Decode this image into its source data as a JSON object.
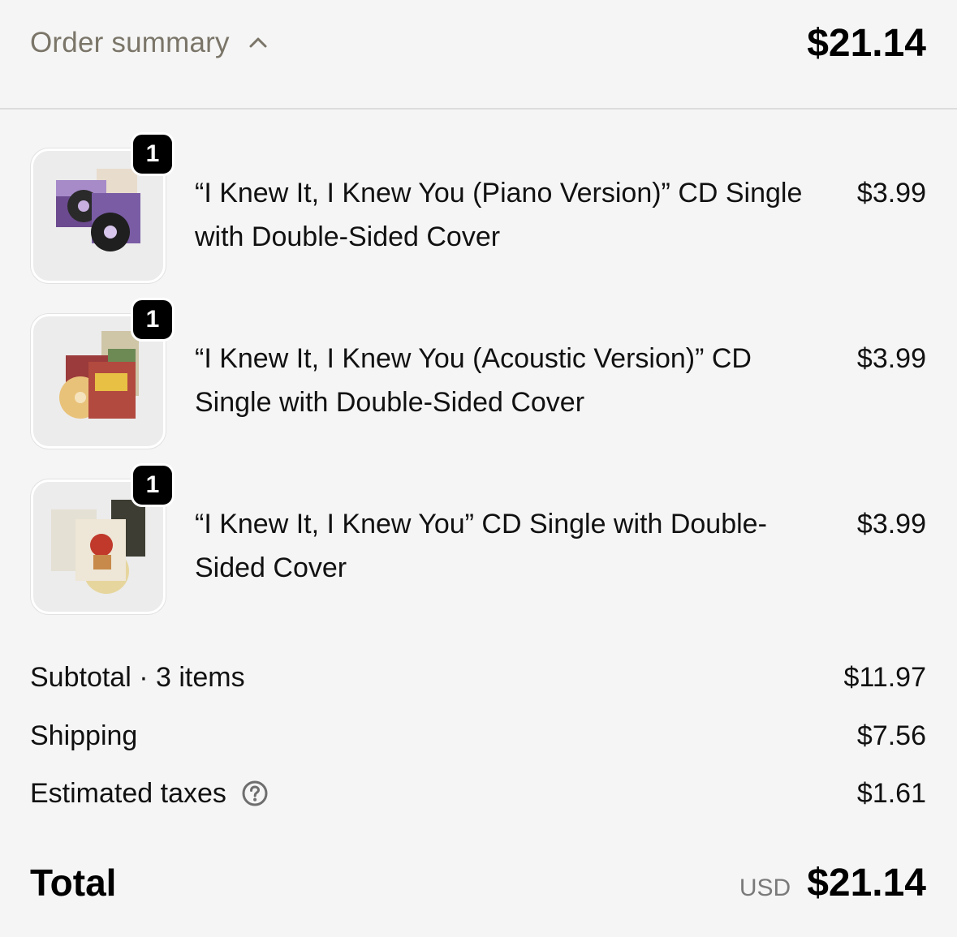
{
  "summary": {
    "title": "Order summary",
    "total": "$21.14"
  },
  "items": [
    {
      "name": "“I Knew It, I Knew You (Piano Version)” CD Single with Double-Sided Cover",
      "price": "$3.99",
      "quantity": "1"
    },
    {
      "name": "“I Knew It, I Knew You (Acoustic Version)” CD Single with Double-Sided Cover",
      "price": "$3.99",
      "quantity": "1"
    },
    {
      "name": "“I Knew It, I Knew You” CD Single with Double-Sided Cover",
      "price": "$3.99",
      "quantity": "1"
    }
  ],
  "totals": {
    "subtotal_label": "Subtotal · 3 items",
    "subtotal_value": "$11.97",
    "shipping_label": "Shipping",
    "shipping_value": "$7.56",
    "taxes_label": "Estimated taxes",
    "taxes_value": "$1.61",
    "total_label": "Total",
    "currency": "USD",
    "total_value": "$21.14"
  },
  "icons": {
    "toggle": "chevron-up-icon",
    "taxes_help": "question-circle-icon"
  },
  "colors": {
    "background": "#f5f5f5",
    "muted_text": "#7a7568",
    "badge": "#000000"
  }
}
